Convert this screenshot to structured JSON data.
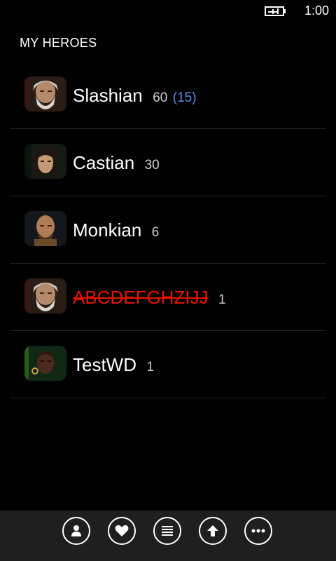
{
  "status_bar": {
    "time": "1:00",
    "battery_icon": "battery-charging-icon"
  },
  "page": {
    "title": "MY HEROES"
  },
  "heroes": [
    {
      "name": "Slashian",
      "level": "60",
      "paragon": "(15)",
      "dead": false,
      "portrait": "barbarian-portrait"
    },
    {
      "name": "Castian",
      "level": "30",
      "paragon": "",
      "dead": false,
      "portrait": "wizard-portrait"
    },
    {
      "name": "Monkian",
      "level": "6",
      "paragon": "",
      "dead": false,
      "portrait": "monk-portrait"
    },
    {
      "name": "ABCDEFGHZIJJ",
      "level": "1",
      "paragon": "",
      "dead": true,
      "portrait": "barbarian-portrait"
    },
    {
      "name": "TestWD",
      "level": "1",
      "paragon": "",
      "dead": false,
      "portrait": "witch-doctor-portrait"
    }
  ],
  "app_bar": {
    "buttons": [
      {
        "icon": "person-icon"
      },
      {
        "icon": "heart-icon"
      },
      {
        "icon": "list-icon"
      },
      {
        "icon": "upload-icon"
      },
      {
        "icon": "more-icon"
      }
    ]
  },
  "colors": {
    "paragon": "#5b8ee6",
    "dead_hero": "#e51400",
    "app_bar_bg": "#1f1f1f"
  }
}
